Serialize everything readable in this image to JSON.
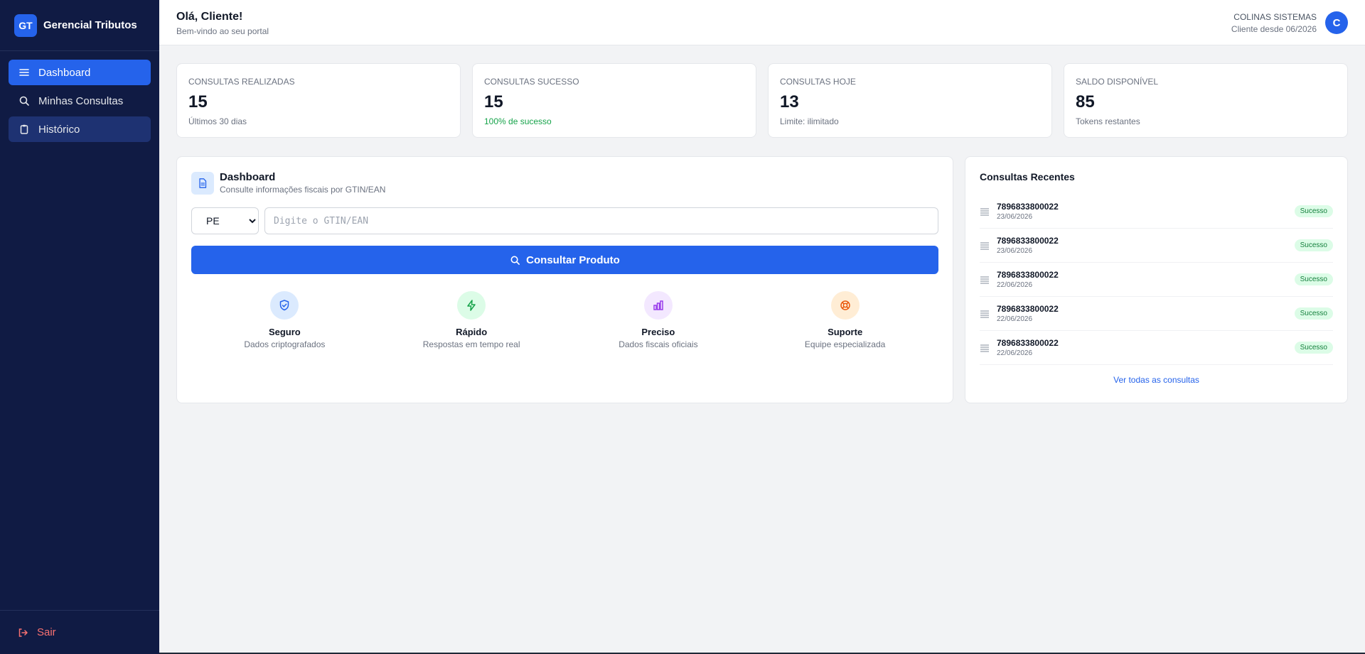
{
  "sidebar": {
    "logo": "GT",
    "brand": "Gerencial Tributos",
    "items": [
      {
        "label": "Dashboard",
        "icon": "menu-icon"
      },
      {
        "label": "Minhas Consultas",
        "icon": "search-icon"
      },
      {
        "label": "Histórico",
        "icon": "clipboard-icon"
      }
    ],
    "logout": "Sair"
  },
  "header": {
    "title": "Olá, Cliente!",
    "subtitle": "Bem-vindo ao seu portal",
    "company": "COLINAS SISTEMAS",
    "member_since": "Cliente desde 06/2026",
    "avatar": "C"
  },
  "stats": [
    {
      "label": "Consultas Realizadas",
      "value": "15",
      "note": "Últimos 30 dias"
    },
    {
      "label": "Consultas Sucesso",
      "value": "15",
      "note": "100% de sucesso"
    },
    {
      "label": "Consultas Hoje",
      "value": "13",
      "note": "Limite: ilimitado"
    },
    {
      "label": "Saldo Disponível",
      "value": "85",
      "note": "Tokens restantes"
    }
  ],
  "main": {
    "title": "Dashboard",
    "subtitle": "Consulte informações fiscais por GTIN/EAN",
    "state_selected": "PE",
    "input_placeholder": "Digite o GTIN/EAN",
    "button": "Consultar Produto",
    "features": [
      {
        "title": "Seguro",
        "sub": "Dados criptografados",
        "icon": "shield-icon",
        "color": "#2563eb",
        "bg": "#dbeafe"
      },
      {
        "title": "Rápido",
        "sub": "Respostas em tempo real",
        "icon": "lightning-icon",
        "color": "#16a34a",
        "bg": "#dcfce7"
      },
      {
        "title": "Preciso",
        "sub": "Dados fiscais oficiais",
        "icon": "bar-chart-icon",
        "color": "#9333ea",
        "bg": "#f3e8ff"
      },
      {
        "title": "Suporte",
        "sub": "Equipe especializada",
        "icon": "lifebuoy-icon",
        "color": "#ea580c",
        "bg": "#ffedd5"
      }
    ]
  },
  "recent": {
    "title": "Consultas Recentes",
    "items": [
      {
        "code": "7896833800022",
        "date": "23/06/2026",
        "status": "Sucesso"
      },
      {
        "code": "7896833800022",
        "date": "23/06/2026",
        "status": "Sucesso"
      },
      {
        "code": "7896833800022",
        "date": "22/06/2026",
        "status": "Sucesso"
      },
      {
        "code": "7896833800022",
        "date": "22/06/2026",
        "status": "Sucesso"
      },
      {
        "code": "7896833800022",
        "date": "22/06/2026",
        "status": "Sucesso"
      }
    ],
    "see_all": "Ver todas as consultas"
  },
  "colors": {
    "sidebar_bg": "#101b44",
    "accent": "#2563eb",
    "success": "#16a34a",
    "danger": "#f87171"
  }
}
